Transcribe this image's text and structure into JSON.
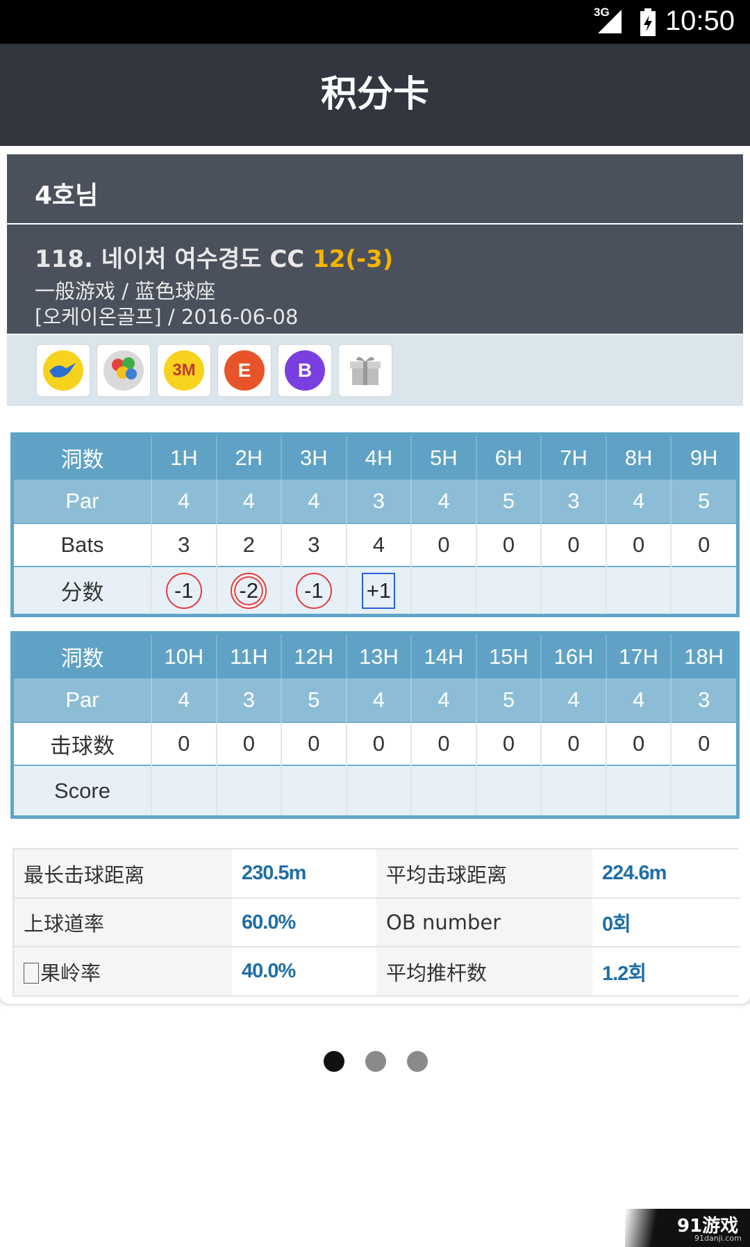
{
  "status_bar": {
    "time": "10:50",
    "network": "3G"
  },
  "app_bar": {
    "title": "积分卡"
  },
  "hole": {
    "name": "4호님"
  },
  "course": {
    "name": "118. 네이처 여수경도 CC",
    "score": "12(-3)",
    "mode": "一般游戏 / 蓝色球座",
    "info": "[오케이온골프] / 2016-06-08"
  },
  "badges": [
    {
      "icon": "bird-icon",
      "text": "",
      "color": "#f7d21e"
    },
    {
      "icon": "balloons-icon",
      "text": "",
      "color": "#cccccc"
    },
    {
      "icon": "3m-badge-icon",
      "text": "3M",
      "color": "#f7d21e"
    },
    {
      "icon": "e-badge-icon",
      "text": "E",
      "color": "#e8542a"
    },
    {
      "icon": "b-badge-icon",
      "text": "B",
      "color": "#7a3fe0"
    },
    {
      "icon": "gift-icon",
      "text": "",
      "color": "#bdbdbd"
    }
  ],
  "front_nine": {
    "header_label": "洞数",
    "holes": [
      "1H",
      "2H",
      "3H",
      "4H",
      "5H",
      "6H",
      "7H",
      "8H",
      "9H"
    ],
    "par_label": "Par",
    "pars": [
      "4",
      "4",
      "4",
      "3",
      "4",
      "5",
      "3",
      "4",
      "5"
    ],
    "bats_label": "Bats",
    "bats": [
      "3",
      "2",
      "3",
      "4",
      "0",
      "0",
      "0",
      "0",
      "0"
    ],
    "score_label": "分数",
    "scores": [
      {
        "text": "-1",
        "type": "birdie"
      },
      {
        "text": "-2",
        "type": "eagle"
      },
      {
        "text": "-1",
        "type": "birdie"
      },
      {
        "text": "+1",
        "type": "bogey"
      },
      {
        "text": "",
        "type": "none"
      },
      {
        "text": "",
        "type": "none"
      },
      {
        "text": "",
        "type": "none"
      },
      {
        "text": "",
        "type": "none"
      },
      {
        "text": "",
        "type": "none"
      }
    ]
  },
  "back_nine": {
    "header_label": "洞数",
    "holes": [
      "10H",
      "11H",
      "12H",
      "13H",
      "14H",
      "15H",
      "16H",
      "17H",
      "18H"
    ],
    "par_label": "Par",
    "pars": [
      "4",
      "3",
      "5",
      "4",
      "4",
      "5",
      "4",
      "4",
      "3"
    ],
    "bats_label": "击球数",
    "bats": [
      "0",
      "0",
      "0",
      "0",
      "0",
      "0",
      "0",
      "0",
      "0"
    ],
    "score_label": "Score",
    "scores": [
      "",
      "",
      "",
      "",
      "",
      "",
      "",
      "",
      ""
    ]
  },
  "stats": [
    {
      "k1": "最长击球距离",
      "v1": "230.5m",
      "k2": "平均击球距离",
      "v2": "224.6m"
    },
    {
      "k1": "上球道率",
      "v1": "60.0%",
      "k2": "OB number",
      "v2": "0회"
    },
    {
      "k1": "果岭率",
      "v1": "40.0%",
      "k2": "平均推杆数",
      "v2": "1.2회"
    }
  ],
  "pager": {
    "count": 3,
    "active": 0
  },
  "watermark": {
    "main": "91游戏",
    "sub": "91danji.com"
  }
}
